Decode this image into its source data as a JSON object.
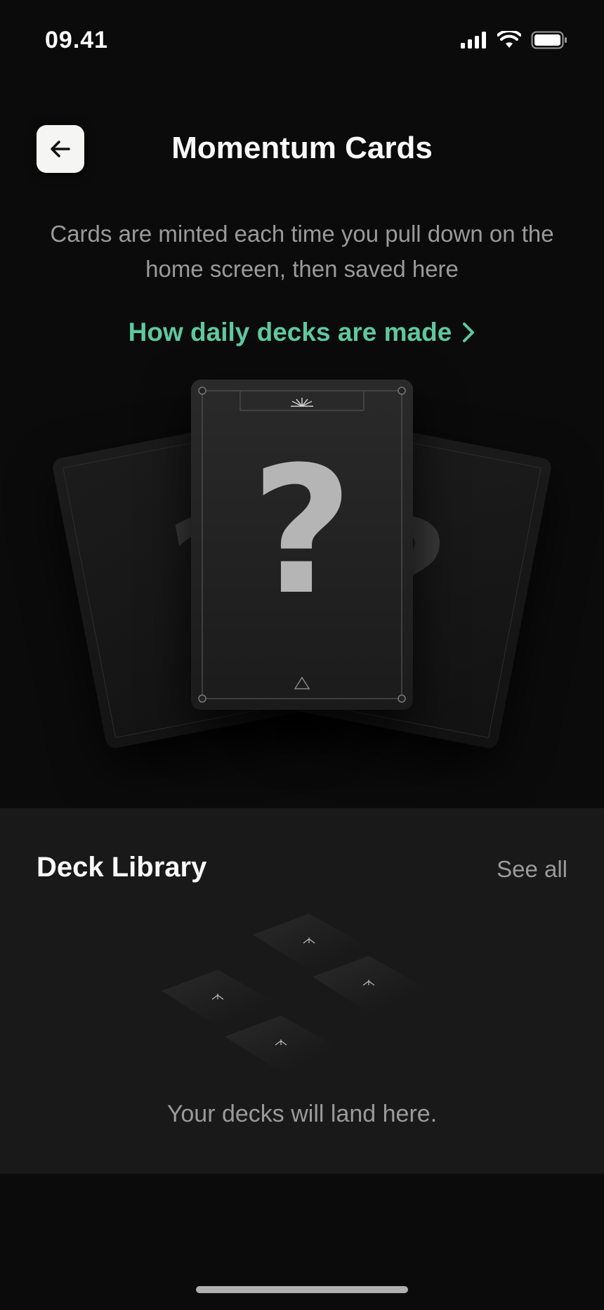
{
  "status_bar": {
    "time": "09.41",
    "icons": [
      "cellular-signal-icon",
      "wifi-icon",
      "battery-icon"
    ]
  },
  "header": {
    "title": "Momentum Cards",
    "back_icon": "arrow-left-icon"
  },
  "intro": {
    "subtitle": "Cards are minted each time you pull down on the home screen, then saved here",
    "link_label": "How daily decks are made",
    "link_icon": "chevron-right-icon"
  },
  "featured_cards": {
    "left_symbol": "?",
    "center_symbol": "?",
    "right_symbol": "?"
  },
  "library": {
    "title": "Deck Library",
    "see_all_label": "See all",
    "empty_message": "Your decks will land here."
  },
  "colors": {
    "accent": "#5fc89f",
    "background": "#0b0b0b",
    "panel": "#191919"
  }
}
